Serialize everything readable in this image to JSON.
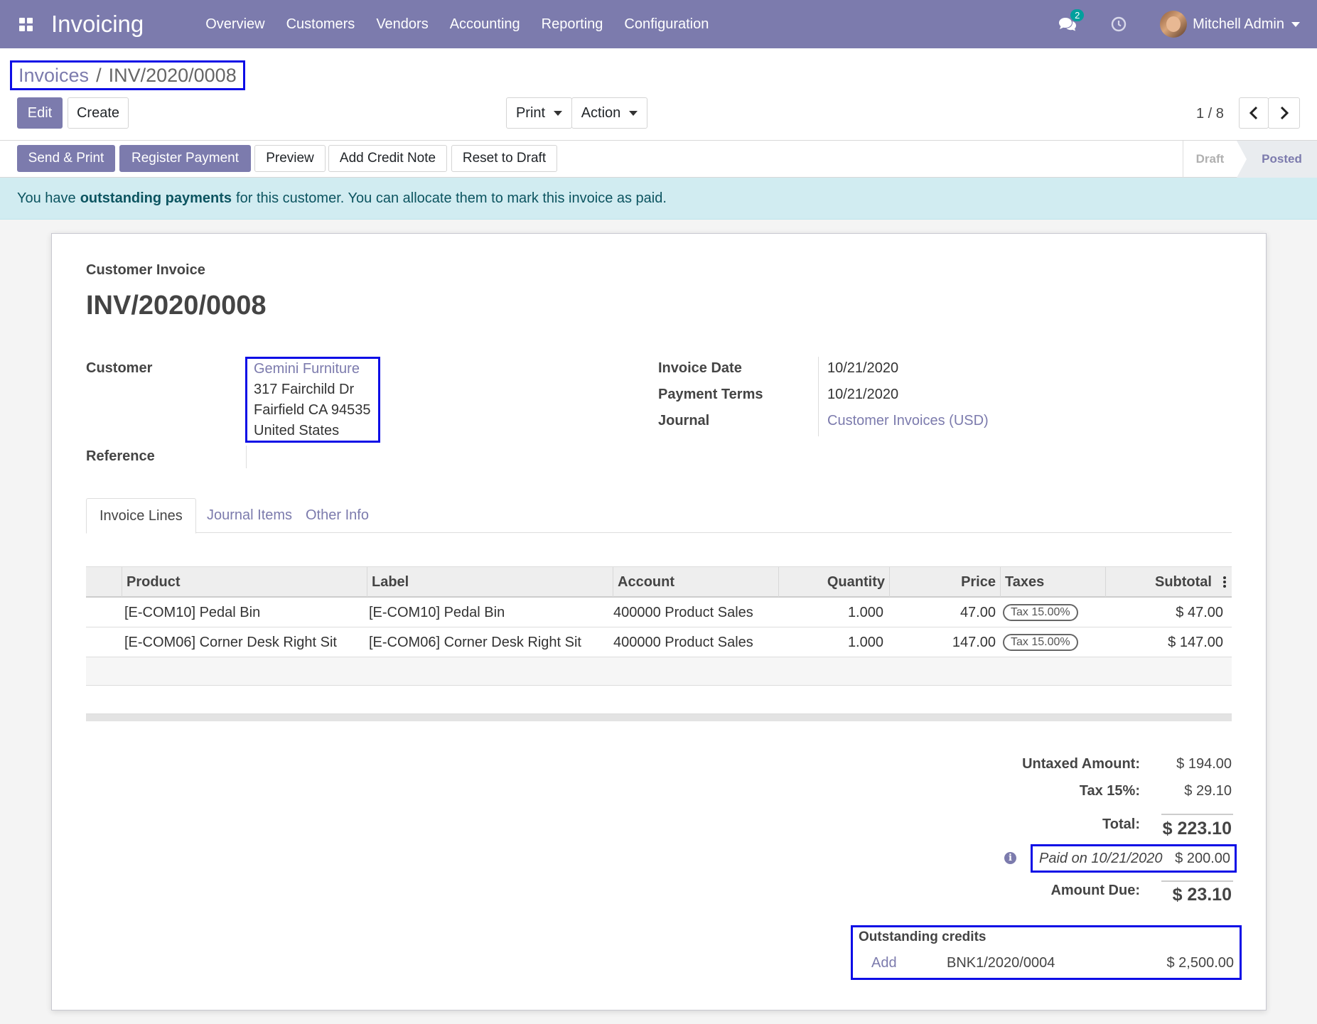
{
  "navbar": {
    "app_title": "Invoicing",
    "menu": [
      "Overview",
      "Customers",
      "Vendors",
      "Accounting",
      "Reporting",
      "Configuration"
    ],
    "chat_badge": "2",
    "user_name": "Mitchell Admin"
  },
  "breadcrumb": {
    "parent": "Invoices",
    "separator": "/",
    "current": "INV/2020/0008"
  },
  "control": {
    "edit_label": "Edit",
    "create_label": "Create",
    "print_label": "Print",
    "action_label": "Action",
    "pager": "1 / 8"
  },
  "statusbar": {
    "buttons": [
      "Send & Print",
      "Register Payment",
      "Preview",
      "Add Credit Note",
      "Reset to Draft"
    ],
    "stages": {
      "draft": "Draft",
      "posted": "Posted"
    }
  },
  "alert": {
    "prefix": "You have",
    "bold": "outstanding payments",
    "suffix": "for this customer. You can allocate them to mark this invoice as paid."
  },
  "invoice": {
    "type_label": "Customer Invoice",
    "number": "INV/2020/0008",
    "customer_label": "Customer",
    "customer_name": "Gemini Furniture",
    "address": [
      "317 Fairchild Dr",
      "Fairfield CA 94535",
      "United States"
    ],
    "reference_label": "Reference",
    "invoice_date_label": "Invoice Date",
    "invoice_date": "10/21/2020",
    "payment_terms_label": "Payment Terms",
    "payment_terms": "10/21/2020",
    "journal_label": "Journal",
    "journal": "Customer Invoices (USD)"
  },
  "tabs": [
    "Invoice Lines",
    "Journal Items",
    "Other Info"
  ],
  "lines": {
    "headers": {
      "product": "Product",
      "label": "Label",
      "account": "Account",
      "quantity": "Quantity",
      "price": "Price",
      "taxes": "Taxes",
      "subtotal": "Subtotal"
    },
    "rows": [
      {
        "product": "[E-COM10] Pedal Bin",
        "label": "[E-COM10] Pedal Bin",
        "account": "400000 Product Sales",
        "quantity": "1.000",
        "price": "47.00",
        "tax": "Tax 15.00%",
        "subtotal": "$ 47.00"
      },
      {
        "product": "[E-COM06] Corner Desk Right Sit",
        "label": "[E-COM06] Corner Desk Right Sit",
        "account": "400000 Product Sales",
        "quantity": "1.000",
        "price": "147.00",
        "tax": "Tax 15.00%",
        "subtotal": "$ 147.00"
      }
    ]
  },
  "totals": {
    "untaxed_label": "Untaxed Amount:",
    "untaxed": "$ 194.00",
    "tax_label": "Tax 15%:",
    "tax": "$ 29.10",
    "total_label": "Total:",
    "total": "$ 223.10",
    "paid_text": "Paid on 10/21/2020",
    "paid_amount": "$ 200.00",
    "due_label": "Amount Due:",
    "due": "$ 23.10"
  },
  "outstanding": {
    "title": "Outstanding credits",
    "add_label": "Add",
    "ref": "BNK1/2020/0004",
    "amount": "$ 2,500.00"
  },
  "colors": {
    "brand": "#7c7bad",
    "highlight_box": "#0d0de6",
    "alert_bg": "#d1ecf1"
  }
}
